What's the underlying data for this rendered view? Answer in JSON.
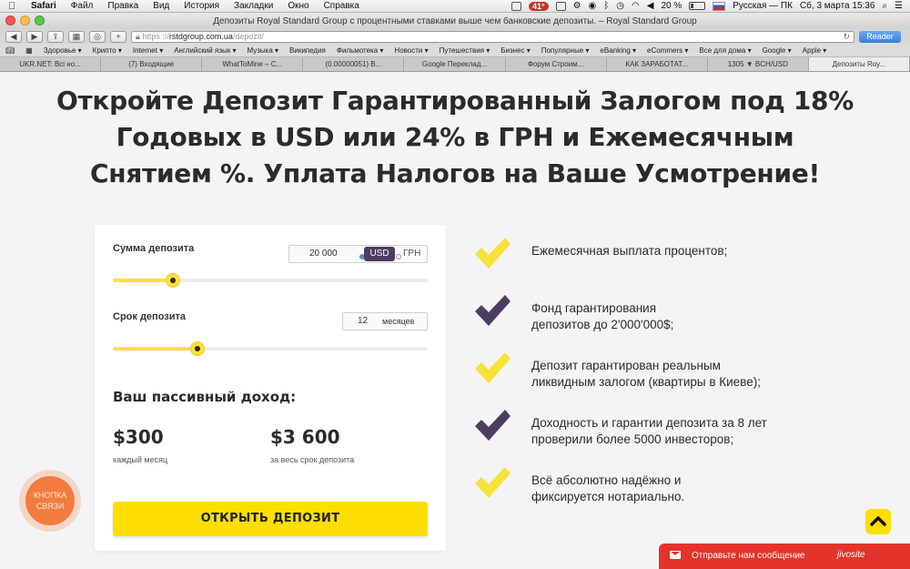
{
  "menubar": {
    "app": "Safari",
    "items": [
      "Файл",
      "Правка",
      "Вид",
      "История",
      "Закладки",
      "Окно",
      "Справка"
    ],
    "temp": "41°",
    "battery": "20 %",
    "input_source": "Русская — ПК",
    "datetime": "Сб, 3 марта  15:36"
  },
  "window": {
    "title": "Депозиты Royal Standard Group с процентными ставками выше чем банковские депозиты. – Royal Standard Group"
  },
  "toolbar": {
    "url_scheme": "https",
    "url_domain": "rstdgroup.com.ua",
    "url_path": "/depozit/",
    "reader_label": "Reader"
  },
  "bookmarks": [
    "Здоровье ▾",
    "Крипто ▾",
    "Internet ▾",
    "Английский язык ▾",
    "Музыка ▾",
    "Википедия",
    "Фильмотека ▾",
    "Новости ▾",
    "Путешествия ▾",
    "Бизнес ▾",
    "Популярные ▾",
    "eBanking ▾",
    "eCommers ▾",
    "Все для дома ▾",
    "Google ▾",
    "Apple ▾"
  ],
  "tabs": [
    "UKR.NET: Всі но...",
    "(7) Входящие",
    "WhatToMine – C...",
    "(0.00000051) B...",
    "Google Переклад...",
    "Форум Строим...",
    "КАК ЗАРАБОТАТ...",
    "1305 ▼ BCH/USD",
    "Депозиты Roy..."
  ],
  "headline": "Откройте Депозит Гарантированный Залогом под 18% Годовых в USD или 24% в ГРН и Ежемесячным Снятием %. Уплата Налогов на Ваше Усмотрение!",
  "calculator": {
    "amount_label": "Сумма депозита",
    "amount_value": "20 000",
    "currency_selected": "USD",
    "currency_other": "ГРН",
    "amount_slider_fraction": 0.19,
    "term_label": "Срок депозита",
    "term_value": "12",
    "term_unit": "месяцев",
    "term_slider_fraction": 0.27,
    "income_title": "Ваш пассивный доход:",
    "monthly_value": "$300",
    "monthly_caption": "каждый месяц",
    "total_value": "$3 600",
    "total_caption": "за весь срок депозита",
    "open_button": "ОТКРЫТЬ ДЕПОЗИТ"
  },
  "features": [
    {
      "text": "Ежемесячная выплата процентов;",
      "check_color": "#f5e33a"
    },
    {
      "text": "Фонд гарантирования\nдепозитов до 2'000'000$;",
      "check_color": "#4b3f61"
    },
    {
      "text": "Депозит гарантирован реальным\nликвидным залогом (квартиры в Киеве);",
      "check_color": "#f5e33a"
    },
    {
      "text": "Доходность и гарантии депозита за 8 лет\nпроверили более 5000 инвесторов;",
      "check_color": "#4b3f61"
    },
    {
      "text": "Всё абсолютно надёжно и\nфиксируется нотариально.",
      "check_color": "#f5e33a"
    }
  ],
  "callback_button": "КНОПКА\nСВЯЗИ",
  "chat": {
    "message": "Отправьте нам сообщение",
    "brand": "jivosite"
  },
  "colors": {
    "accent_yellow": "#ffdf00",
    "accent_purple": "#4b3f61",
    "callback_orange": "#f37b3d",
    "chat_red": "#e4332b"
  }
}
